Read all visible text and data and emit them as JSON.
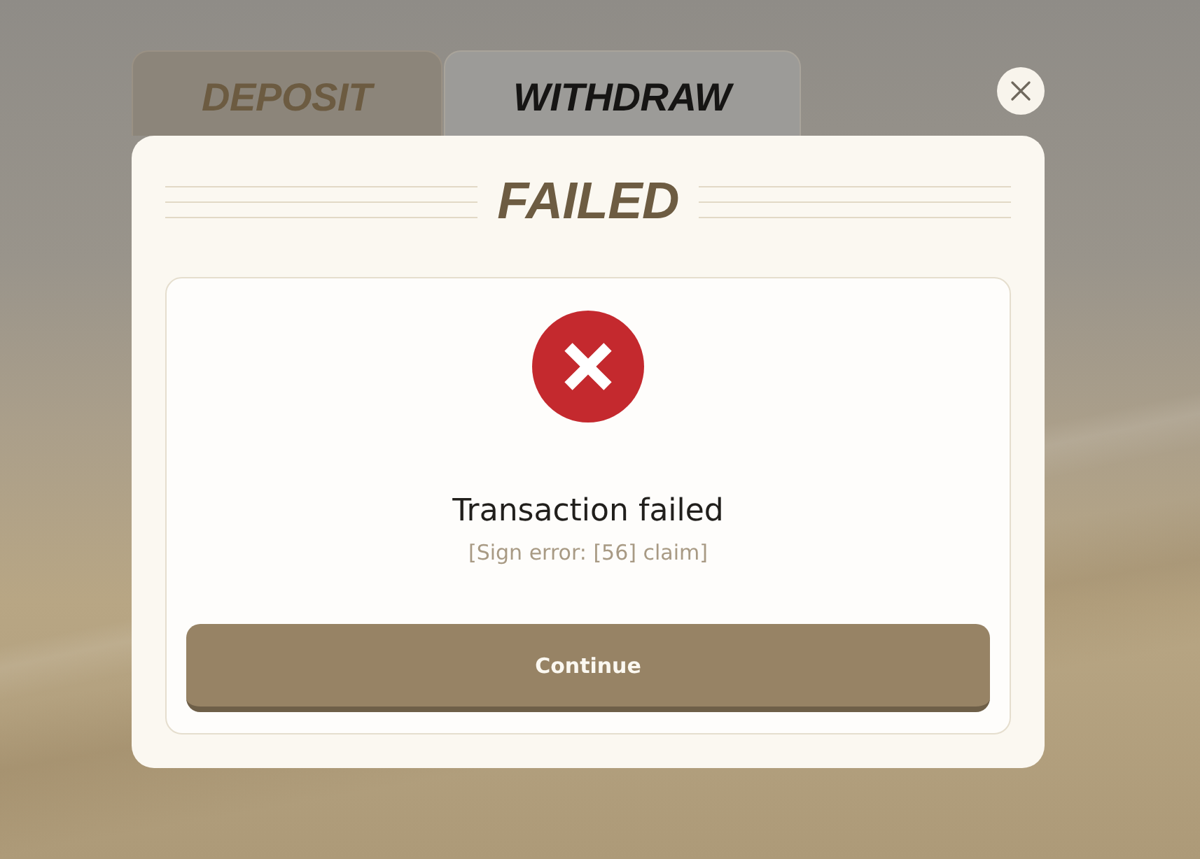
{
  "tabs": [
    {
      "label": "DEPOSIT",
      "selected": false
    },
    {
      "label": "WITHDRAW",
      "selected": true
    }
  ],
  "dialog": {
    "title": "FAILED",
    "status": {
      "kind": "error",
      "message": "Transaction failed",
      "detail": "[Sign error: [56] claim]"
    },
    "buttons": [
      {
        "label": "Continue"
      }
    ]
  }
}
